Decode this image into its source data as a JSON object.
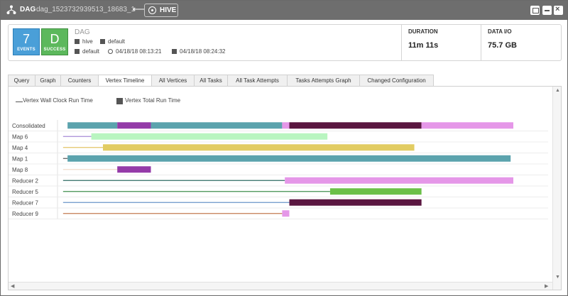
{
  "titlebar": {
    "dag_label": "DAG",
    "dag_id": "dag_1523732939513_18683_1",
    "back_arrow": "⟵",
    "hive_label": "HIVE",
    "close_glyph": "×"
  },
  "summary": {
    "vertices_count": "7",
    "vertices_label": "EVENTS",
    "status_letter": "D",
    "status_label": "SUCCESS",
    "dag_name": "DAG",
    "user": "hive",
    "queue": "default",
    "app": "default",
    "start_time": "04/18/18 08:13:21",
    "end_time": "04/18/18 08:24:32",
    "duration_label": "DURATION",
    "duration_value": "11m 11s",
    "data_io_label": "DATA I/O",
    "data_io_value": "75.7 GB"
  },
  "tabs": [
    {
      "label": "Query"
    },
    {
      "label": "Graph"
    },
    {
      "label": "Counters"
    },
    {
      "label": "Vertex Timeline"
    },
    {
      "label": "All Vertices"
    },
    {
      "label": "All Tasks"
    },
    {
      "label": "All Task Attempts"
    },
    {
      "label": "Tasks Attempts Graph"
    },
    {
      "label": "Changed Configuration"
    }
  ],
  "active_tab": "Vertex Timeline",
  "legend": {
    "wall_clock": "Vertex Wall Clock Run Time",
    "total_run": "Vertex Total Run Time"
  },
  "colors": {
    "accent_blue": "#4a9fd8",
    "success_green": "#5cb85c",
    "titlebar": "#6e6e6e"
  },
  "chart_data": {
    "type": "gantt",
    "timeline_span": [
      0,
      100
    ],
    "rows": [
      {
        "label": "Consolidated",
        "segments": [
          {
            "start": 0.5,
            "end": 11.6,
            "color": "#5ba3ad"
          },
          {
            "start": 11.6,
            "end": 19.1,
            "color": "#943ba8"
          },
          {
            "start": 19.1,
            "end": 48.4,
            "color": "#5ba3ad"
          },
          {
            "start": 48.4,
            "end": 50.0,
            "color": "#e597e8"
          },
          {
            "start": 50.0,
            "end": 79.5,
            "color": "#5a1640"
          },
          {
            "start": 79.5,
            "end": 100.0,
            "color": "#e597e8"
          }
        ]
      },
      {
        "label": "Map 6",
        "wall_start": -0.5,
        "bar_start": 5.8,
        "bar_end": 58.5,
        "line_color": "#a78bd6",
        "bar_color": "#b9f5c0"
      },
      {
        "label": "Map 4",
        "wall_start": -0.5,
        "bar_start": 8.4,
        "bar_end": 77.9,
        "line_color": "#e2c566",
        "bar_color": "#e2cc62"
      },
      {
        "label": "Map 1",
        "wall_start": -0.5,
        "bar_start": 0.5,
        "bar_end": 99.4,
        "line_color": "#555555",
        "bar_color": "#5ba3ad"
      },
      {
        "label": "Map 8",
        "wall_start": -0.5,
        "bar_start": 11.6,
        "bar_end": 19.1,
        "line_color": "#f3dccc",
        "bar_color": "#943ba8"
      },
      {
        "label": "Reducer 2",
        "wall_start": -0.5,
        "bar_start": 49.0,
        "bar_end": 100.0,
        "line_color": "#2e6b63",
        "bar_color": "#e597e8"
      },
      {
        "label": "Reducer 5",
        "wall_start": -0.5,
        "bar_start": 59.1,
        "bar_end": 79.5,
        "line_color": "#3f8f4d",
        "bar_color": "#6bc048"
      },
      {
        "label": "Reducer 7",
        "wall_start": -0.5,
        "bar_start": 50.0,
        "bar_end": 79.5,
        "line_color": "#6a95c9",
        "bar_color": "#5a1640"
      },
      {
        "label": "Reducer 9",
        "wall_start": -0.5,
        "bar_start": 48.4,
        "bar_end": 50.0,
        "line_color": "#c27a50",
        "bar_color": "#e597e8"
      }
    ]
  }
}
